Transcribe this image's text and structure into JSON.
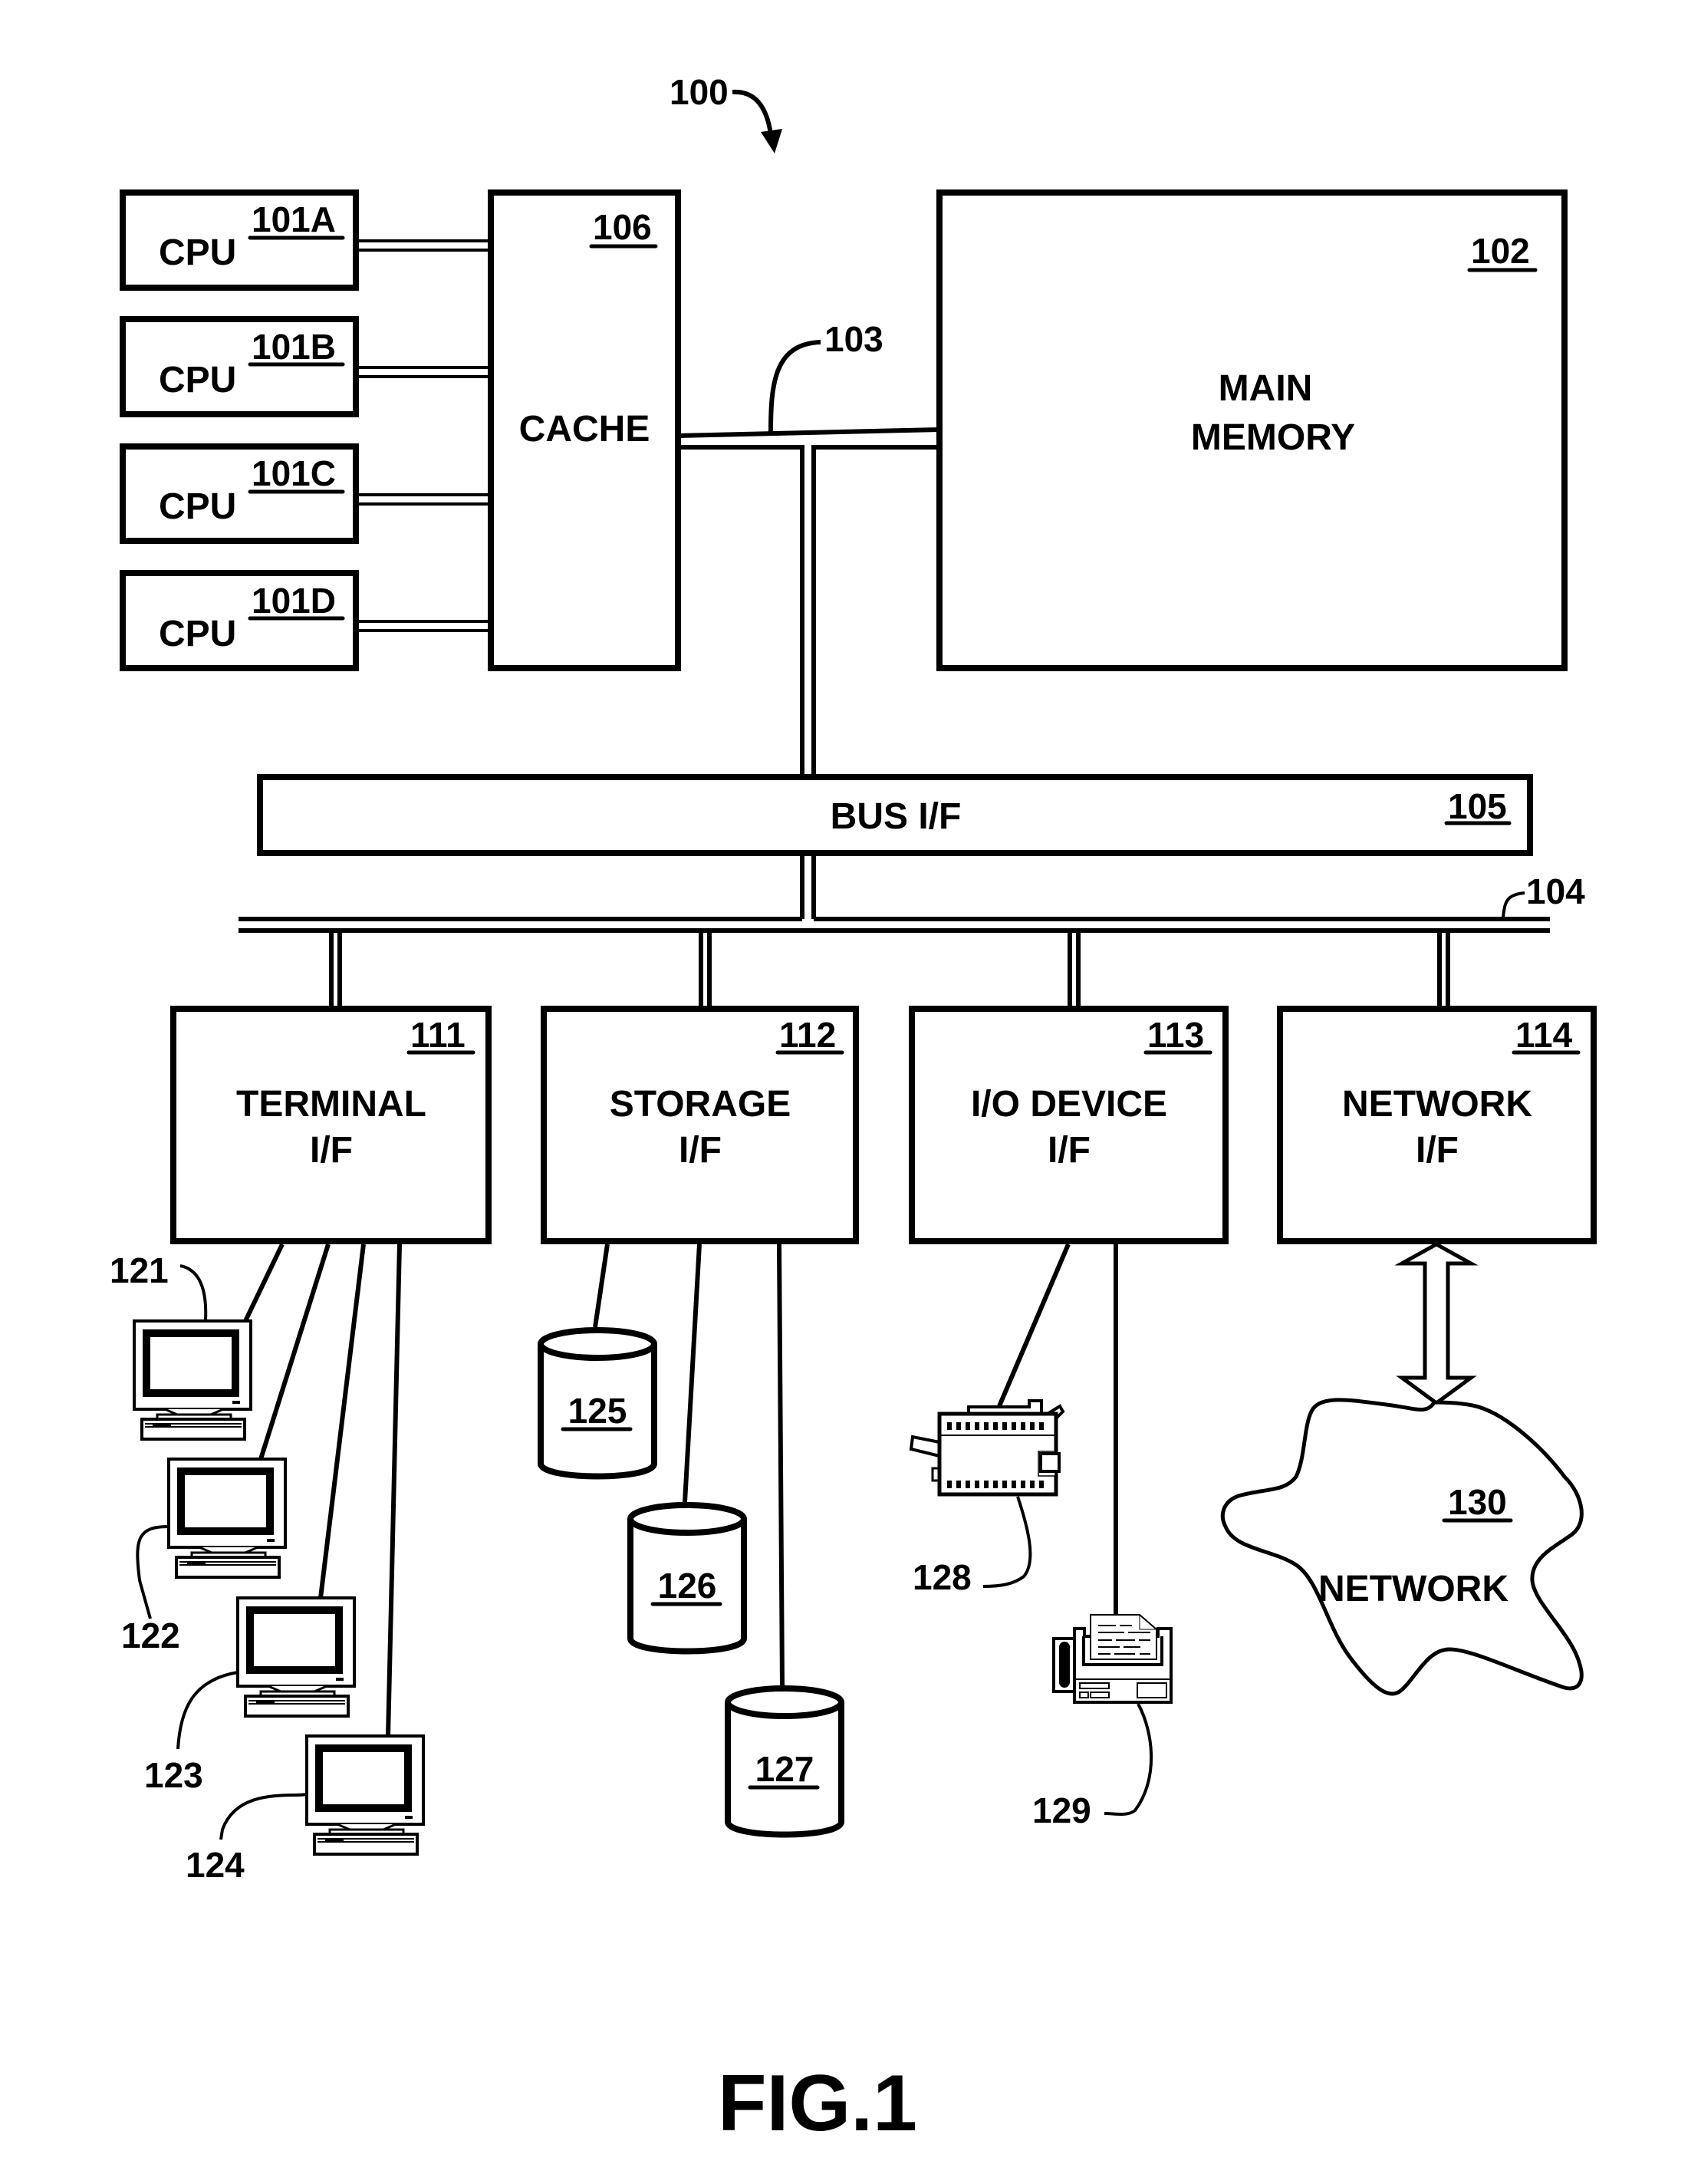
{
  "figure": {
    "system_ref": "100",
    "caption": "FIG.1"
  },
  "cpus": [
    {
      "label": "CPU",
      "ref": "101A"
    },
    {
      "label": "CPU",
      "ref": "101B"
    },
    {
      "label": "CPU",
      "ref": "101C"
    },
    {
      "label": "CPU",
      "ref": "101D"
    }
  ],
  "cache": {
    "label": "CACHE",
    "ref": "106"
  },
  "main_memory": {
    "label_line1": "MAIN",
    "label_line2": "MEMORY",
    "ref": "102"
  },
  "memory_bus": {
    "ref": "103"
  },
  "io_bus": {
    "ref": "104"
  },
  "bus_interface": {
    "label": "BUS I/F",
    "ref": "105"
  },
  "interfaces": [
    {
      "line1": "TERMINAL",
      "line2": "I/F",
      "ref": "111"
    },
    {
      "line1": "STORAGE",
      "line2": "I/F",
      "ref": "112"
    },
    {
      "line1": "I/O DEVICE",
      "line2": "I/F",
      "ref": "113"
    },
    {
      "line1": "NETWORK",
      "line2": "I/F",
      "ref": "114"
    }
  ],
  "terminals": [
    {
      "ref": "121",
      "icon": "computer-terminal-icon"
    },
    {
      "ref": "122",
      "icon": "computer-terminal-icon"
    },
    {
      "ref": "123",
      "icon": "computer-terminal-icon"
    },
    {
      "ref": "124",
      "icon": "computer-terminal-icon"
    }
  ],
  "storage_devices": [
    {
      "ref": "125",
      "icon": "disk-cylinder-icon"
    },
    {
      "ref": "126",
      "icon": "disk-cylinder-icon"
    },
    {
      "ref": "127",
      "icon": "disk-cylinder-icon"
    }
  ],
  "io_devices": [
    {
      "ref": "128",
      "icon": "printer-icon"
    },
    {
      "ref": "129",
      "icon": "fax-machine-icon"
    }
  ],
  "network": {
    "label": "NETWORK",
    "ref": "130"
  }
}
